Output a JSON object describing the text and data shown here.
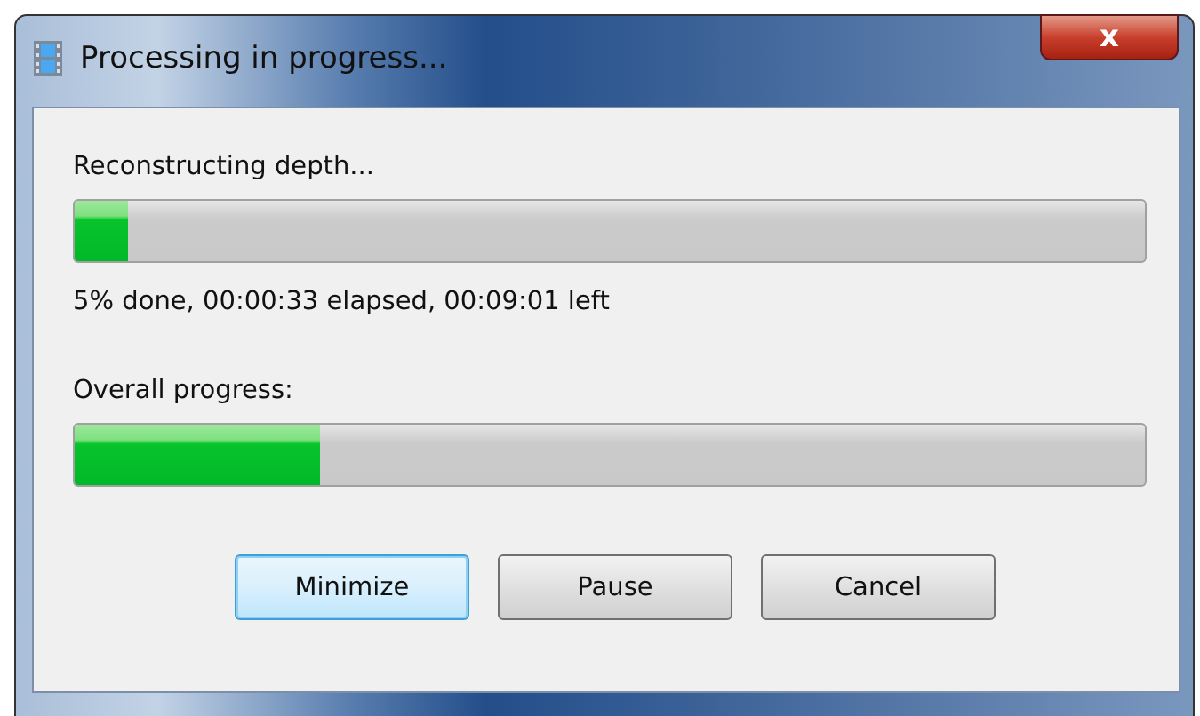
{
  "window": {
    "title": "Processing in progress...",
    "close_glyph": "x"
  },
  "task": {
    "label": "Reconstructing depth...",
    "level": 0.05,
    "status": "5% done, 00:00:33 elapsed, 00:09:01 left"
  },
  "overall": {
    "label": "Overall progress:",
    "level": 0.23
  },
  "buttons": [
    {
      "label": "Minimize",
      "focused": true
    },
    {
      "label": "Pause",
      "focused": false
    },
    {
      "label": "Cancel",
      "focused": false
    }
  ]
}
